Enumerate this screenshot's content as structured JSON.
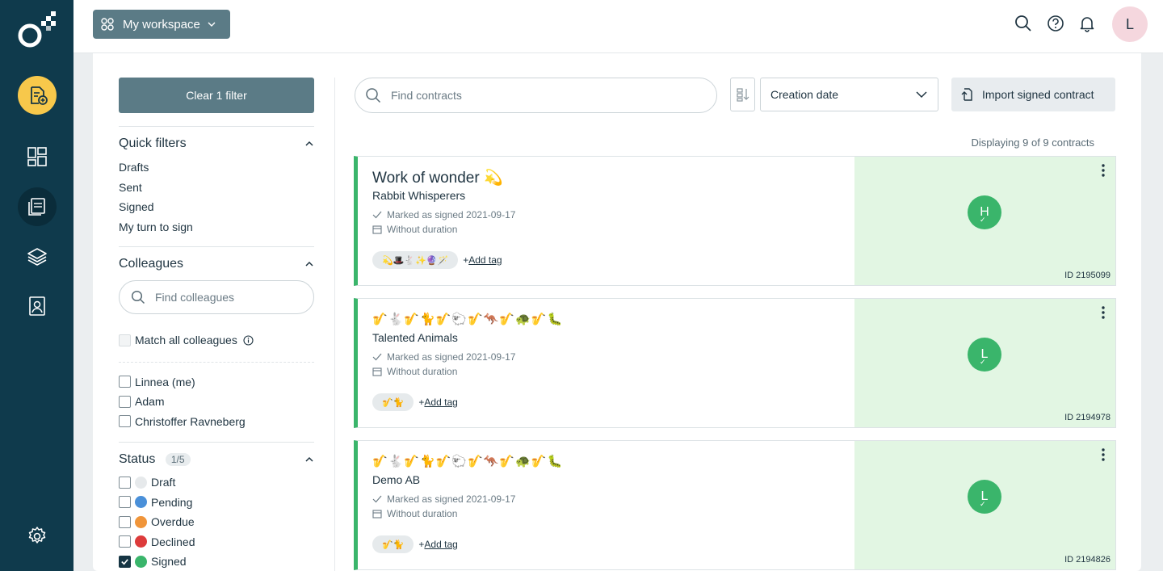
{
  "workspace": {
    "label": "My workspace"
  },
  "user": {
    "initial": "L"
  },
  "filters": {
    "clear_label": "Clear 1 filter",
    "quick": {
      "title": "Quick filters",
      "items": [
        "Drafts",
        "Sent",
        "Signed",
        "My turn to sign"
      ]
    },
    "colleagues": {
      "title": "Colleagues",
      "search_placeholder": "Find colleagues",
      "match_all_label": "Match all colleagues",
      "people": [
        "Linnea (me)",
        "Adam",
        "Christoffer Ravneberg"
      ]
    },
    "status": {
      "title": "Status",
      "count": "1/5",
      "items": [
        {
          "label": "Draft",
          "color": "#e6e9eb",
          "checked": false
        },
        {
          "label": "Pending",
          "color": "#4a90d9",
          "checked": false
        },
        {
          "label": "Overdue",
          "color": "#f0953a",
          "checked": false
        },
        {
          "label": "Declined",
          "color": "#dd3b3b",
          "checked": false
        },
        {
          "label": "Signed",
          "color": "#3ab56b",
          "checked": true
        }
      ]
    }
  },
  "toolbar": {
    "search_placeholder": "Find contracts",
    "sort_value": "Creation date",
    "import_label": "Import signed contract"
  },
  "displaying": "Displaying 9 of 9 contracts",
  "contracts": [
    {
      "title": "Work of wonder 💫",
      "company": "Rabbit Whisperers",
      "status": "Marked as signed 2021-09-17",
      "duration": "Without duration",
      "tag": "💫🎩🐇✨🔮🪄",
      "add_tag_plus": "+",
      "add_tag": "Add tag",
      "signer": "H",
      "id": "ID 2195099"
    },
    {
      "title": "🎷🐇🎷🐈🎷🐑🎷🦘🎷🐢🎷🐛",
      "company": "Talented Animals",
      "status": "Marked as signed 2021-09-17",
      "duration": "Without duration",
      "tag": "🎷🐈",
      "add_tag_plus": "+",
      "add_tag": "Add tag",
      "signer": "L",
      "id": "ID 2194978"
    },
    {
      "title": "🎷🐇🎷🐈🎷🐑🎷🦘🎷🐢🎷🐛",
      "company": "Demo AB",
      "status": "Marked as signed 2021-09-17",
      "duration": "Without duration",
      "tag": "🎷🐈",
      "add_tag_plus": "+",
      "add_tag": "Add tag",
      "signer": "L",
      "id": "ID 2194826"
    }
  ]
}
